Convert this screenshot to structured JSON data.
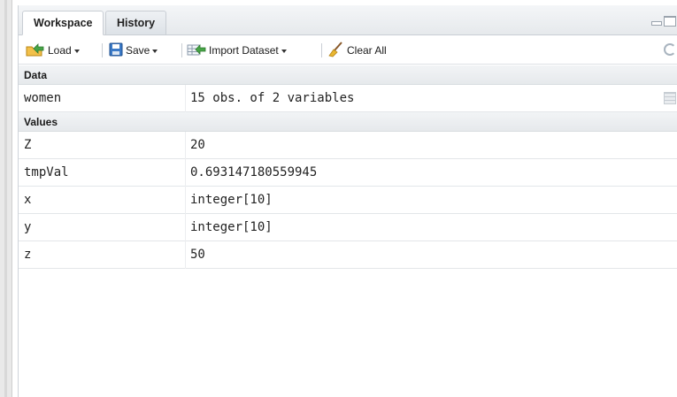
{
  "tabs": [
    {
      "label": "Workspace",
      "active": true
    },
    {
      "label": "History",
      "active": false
    }
  ],
  "toolbar": {
    "load_label": "Load",
    "save_label": "Save",
    "import_label": "Import Dataset",
    "clear_label": "Clear All"
  },
  "workspace": {
    "data_header": "Data",
    "data_rows": [
      {
        "name": "women",
        "value": "15 obs. of 2 variables"
      }
    ],
    "values_header": "Values",
    "value_rows": [
      {
        "name": "Z",
        "value": "20"
      },
      {
        "name": "tmpVal",
        "value": "0.693147180559945"
      },
      {
        "name": "x",
        "value": "integer[10]"
      },
      {
        "name": "y",
        "value": "integer[10]"
      },
      {
        "name": "z",
        "value": "50"
      }
    ]
  },
  "colors": {
    "section_bg": "#e8ebee",
    "border": "#c9ced4",
    "load_icon": "#e2a21f",
    "save_icon": "#2f6db5",
    "import_icon": "#3a8f3a",
    "clear_icon": "#d8a321"
  },
  "icons": [
    "load-icon",
    "save-icon",
    "import-icon",
    "broom-icon",
    "refresh-icon",
    "grid-view-icon",
    "minimize-icon",
    "maximize-icon"
  ]
}
